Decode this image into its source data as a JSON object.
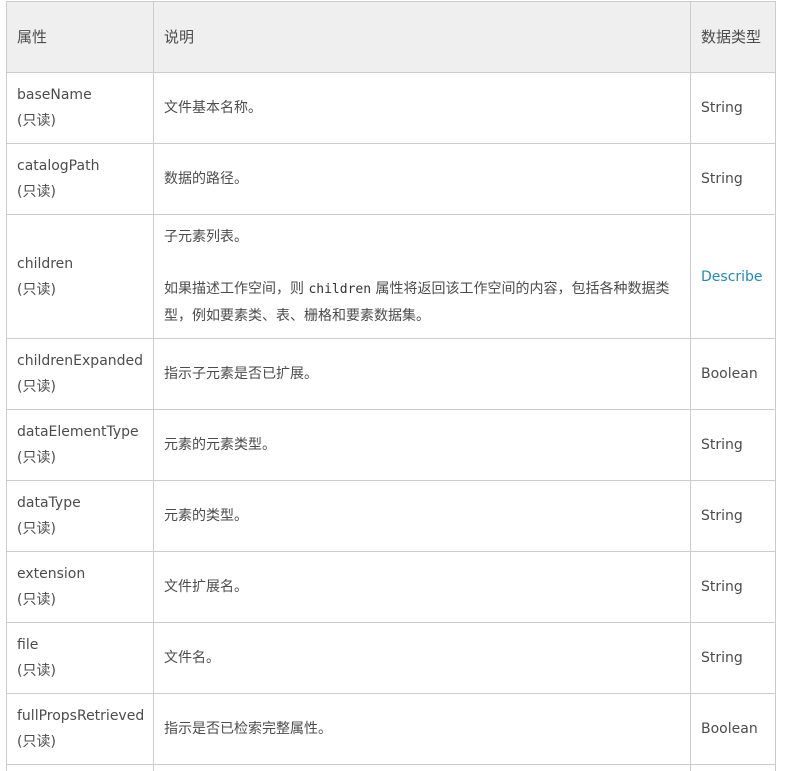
{
  "header": {
    "property": "属性",
    "description": "说明",
    "data_type": "数据类型"
  },
  "rows": [
    {
      "name": "baseName",
      "readonly": "(只读)",
      "description": "文件基本名称。",
      "type": "String"
    },
    {
      "name": "catalogPath",
      "readonly": "(只读)",
      "description": "数据的路径。",
      "type": "String"
    },
    {
      "name": "children",
      "readonly": "(只读)",
      "description_line1": "子元素列表。",
      "description_pre": "如果描述工作空间，则 ",
      "description_code": "children",
      "description_post": " 属性将返回该工作空间的内容，包括各种数据类型，例如要素类、表、栅格和要素数据集。",
      "type": "Describe",
      "type_is_link": true
    },
    {
      "name": "childrenExpanded",
      "readonly": "(只读)",
      "description": "指示子元素是否已扩展。",
      "type": "Boolean"
    },
    {
      "name": "dataElementType",
      "readonly": "(只读)",
      "description": "元素的元素类型。",
      "type": "String"
    },
    {
      "name": "dataType",
      "readonly": "(只读)",
      "description": "元素的类型。",
      "type": "String"
    },
    {
      "name": "extension",
      "readonly": "(只读)",
      "description": "文件扩展名。",
      "type": "String"
    },
    {
      "name": "file",
      "readonly": "(只读)",
      "description": "文件名。",
      "type": "String"
    },
    {
      "name": "fullPropsRetrieved",
      "readonly": "(只读)",
      "description": "指示是否已检索完整属性。",
      "type": "Boolean"
    }
  ],
  "colors": {
    "header_bg": "#efefef",
    "border": "#cccccc",
    "text": "#4c4c4c",
    "link": "#1f8ac0"
  }
}
